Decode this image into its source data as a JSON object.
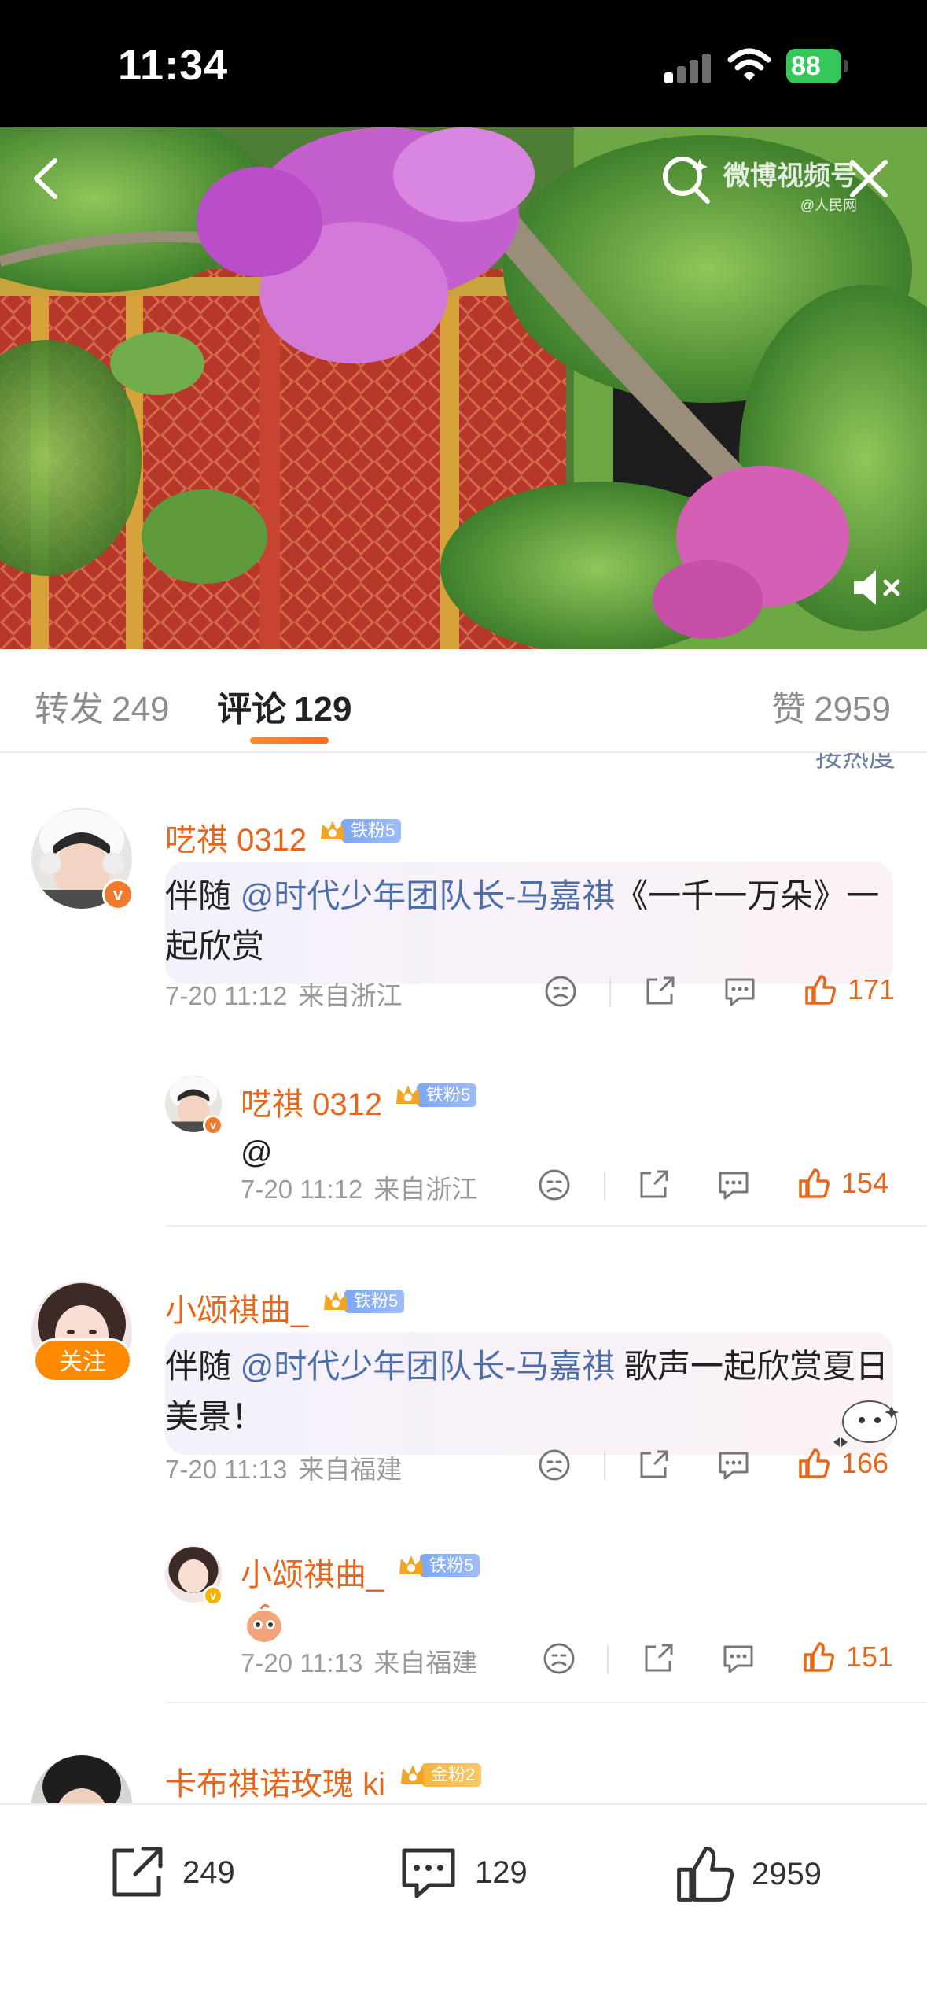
{
  "status_bar": {
    "time": "11:34",
    "battery": "88"
  },
  "video": {
    "watermark": "微博视频号",
    "watermark_sub": "@人民网",
    "icons": [
      "back-icon",
      "search-icon",
      "close-icon",
      "mute-icon"
    ]
  },
  "tabs": {
    "repost_label": "转发",
    "repost_count": "249",
    "comment_label": "评论",
    "comment_count": "129",
    "like_label": "赞",
    "like_count": "2959"
  },
  "comments": [
    {
      "user": "呓祺 0312",
      "badge": "铁粉5",
      "text_prefix": "伴随 ",
      "mention": "@时代少年团队长-马嘉祺",
      "text_suffix": "《一千一万朵》一起欣赏",
      "date": "7-20 11:12",
      "location": "来自浙江",
      "likes": "171",
      "reply": {
        "user": "呓祺 0312",
        "badge": "铁粉5",
        "text": "@",
        "date": "7-20 11:12",
        "location": "来自浙江",
        "likes": "154"
      }
    },
    {
      "user": "小颂祺曲_",
      "badge": "铁粉5",
      "follow_label": "关注",
      "text_prefix": "伴随 ",
      "mention": "@时代少年团队长-马嘉祺",
      "text_suffix": " 歌声一起欣赏夏日美景！",
      "date": "7-20 11:13",
      "location": "来自福建",
      "likes": "166",
      "reply": {
        "user": "小颂祺曲_",
        "badge": "铁粉5",
        "date": "7-20 11:13",
        "location": "来自福建",
        "likes": "151"
      }
    },
    {
      "user": "卡布祺诺玫瑰 ki",
      "badge": "金粉2"
    }
  ],
  "sort_peek": "按热度",
  "bottom_bar": {
    "repost": "249",
    "comment": "129",
    "like": "2959"
  },
  "colors": {
    "accent": "#e8661a",
    "mention": "#4e6ea8",
    "follow": "#ff8a00",
    "tab_underline": "#ff7a24"
  }
}
